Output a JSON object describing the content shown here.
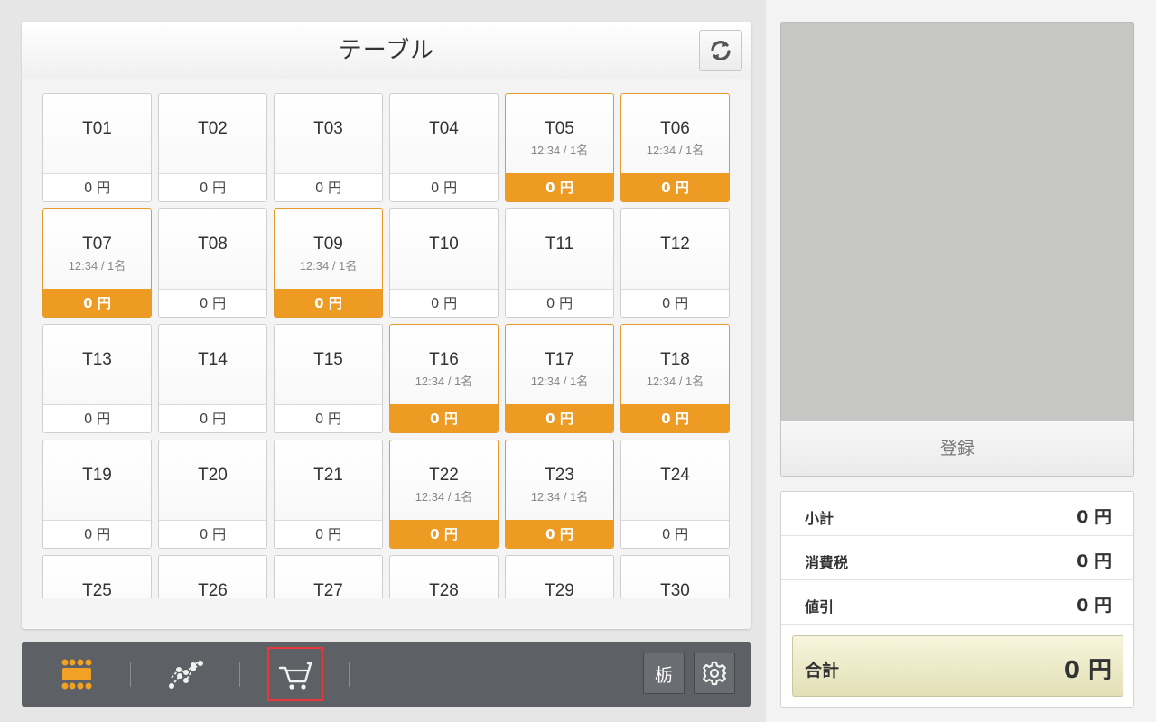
{
  "header": {
    "title": "テーブル"
  },
  "tables": [
    {
      "name": "T01",
      "info": "",
      "price": "0 円",
      "occupied": false
    },
    {
      "name": "T02",
      "info": "",
      "price": "0 円",
      "occupied": false
    },
    {
      "name": "T03",
      "info": "",
      "price": "0 円",
      "occupied": false
    },
    {
      "name": "T04",
      "info": "",
      "price": "0 円",
      "occupied": false
    },
    {
      "name": "T05",
      "info": "12:34 / 1名",
      "price": "0 円",
      "occupied": true
    },
    {
      "name": "T06",
      "info": "12:34 / 1名",
      "price": "0 円",
      "occupied": true
    },
    {
      "name": "T07",
      "info": "12:34 / 1名",
      "price": "0 円",
      "occupied": true
    },
    {
      "name": "T08",
      "info": "",
      "price": "0 円",
      "occupied": false
    },
    {
      "name": "T09",
      "info": "12:34 / 1名",
      "price": "0 円",
      "occupied": true
    },
    {
      "name": "T10",
      "info": "",
      "price": "0 円",
      "occupied": false
    },
    {
      "name": "T11",
      "info": "",
      "price": "0 円",
      "occupied": false
    },
    {
      "name": "T12",
      "info": "",
      "price": "0 円",
      "occupied": false
    },
    {
      "name": "T13",
      "info": "",
      "price": "0 円",
      "occupied": false
    },
    {
      "name": "T14",
      "info": "",
      "price": "0 円",
      "occupied": false
    },
    {
      "name": "T15",
      "info": "",
      "price": "0 円",
      "occupied": false
    },
    {
      "name": "T16",
      "info": "12:34 / 1名",
      "price": "0 円",
      "occupied": true
    },
    {
      "name": "T17",
      "info": "12:34 / 1名",
      "price": "0 円",
      "occupied": true
    },
    {
      "name": "T18",
      "info": "12:34 / 1名",
      "price": "0 円",
      "occupied": true
    },
    {
      "name": "T19",
      "info": "",
      "price": "0 円",
      "occupied": false
    },
    {
      "name": "T20",
      "info": "",
      "price": "0 円",
      "occupied": false
    },
    {
      "name": "T21",
      "info": "",
      "price": "0 円",
      "occupied": false
    },
    {
      "name": "T22",
      "info": "12:34 / 1名",
      "price": "0 円",
      "occupied": true
    },
    {
      "name": "T23",
      "info": "12:34 / 1名",
      "price": "0 円",
      "occupied": true
    },
    {
      "name": "T24",
      "info": "",
      "price": "0 円",
      "occupied": false
    },
    {
      "name": "T25",
      "info": "",
      "price": "",
      "occupied": false
    },
    {
      "name": "T26",
      "info": "",
      "price": "",
      "occupied": false
    },
    {
      "name": "T27",
      "info": "",
      "price": "",
      "occupied": false
    },
    {
      "name": "T28",
      "info": "",
      "price": "",
      "occupied": false
    },
    {
      "name": "T29",
      "info": "",
      "price": "",
      "occupied": false
    },
    {
      "name": "T30",
      "info": "",
      "price": "",
      "occupied": false
    }
  ],
  "toolbar": {
    "icons": [
      "table-grid-icon",
      "chart-line-icon",
      "cart-icon",
      "tochigi-kanji-icon",
      "gear-icon"
    ],
    "kanji_label": "栃",
    "active_icon": "cart-icon"
  },
  "right": {
    "register_label": "登録",
    "subtotal_label": "小計",
    "subtotal_value": "0 円",
    "tax_label": "消費税",
    "tax_value": "0 円",
    "discount_label": "値引",
    "discount_value": "0 円",
    "total_label": "合計",
    "total_value": "0 円"
  },
  "colors": {
    "occupied": "#ee9b24",
    "toolbar": "#5d6064",
    "active_outline": "#e8373d",
    "total_bg": "#efecc9"
  }
}
